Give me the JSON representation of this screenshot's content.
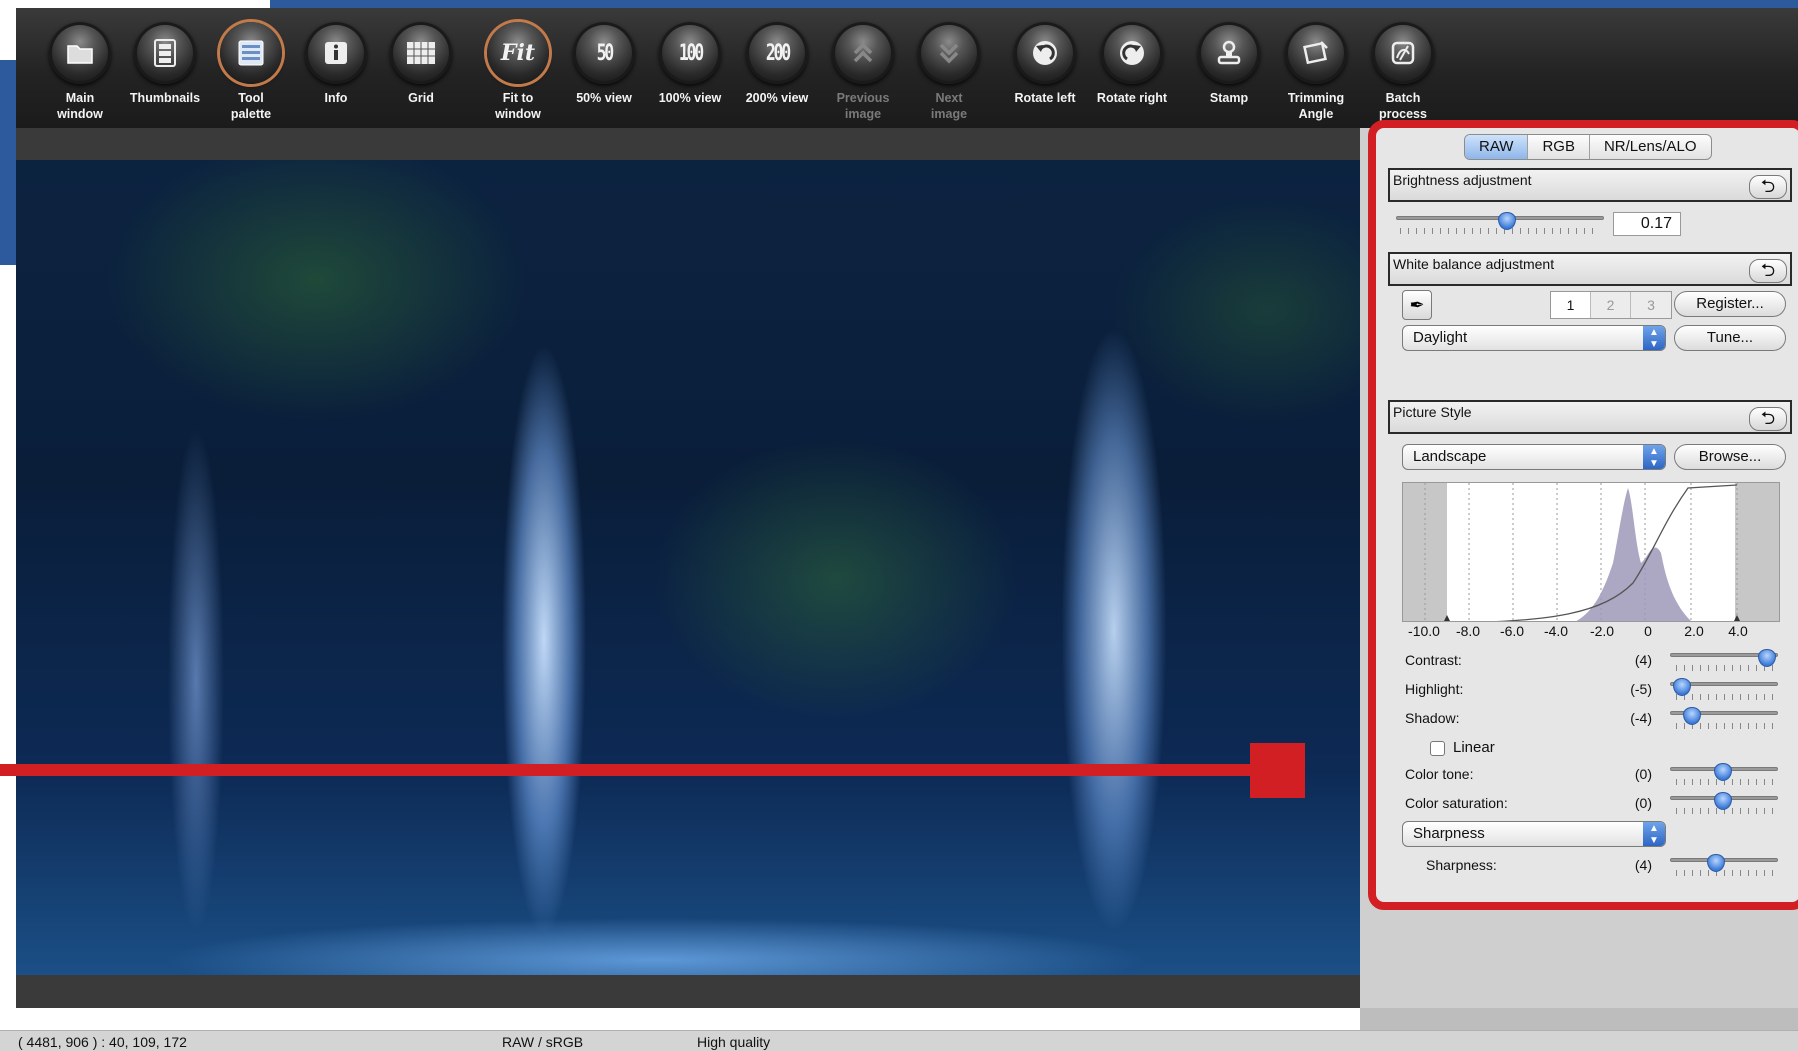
{
  "colors": {
    "toolbar_bg": "#232323",
    "callout_red": "#d21f24",
    "accent_blue": "#2c5a9c",
    "slider_thumb": "#3b7ad8"
  },
  "toolbar": {
    "buttons": [
      {
        "label": "Main\nwindow",
        "icon": "folder-icon"
      },
      {
        "label": "Thumbnails",
        "icon": "thumbnails-icon"
      },
      {
        "label": "Tool\npalette",
        "icon": "tool-palette-icon"
      },
      {
        "label": "Info",
        "icon": "info-icon"
      },
      {
        "label": "Grid",
        "icon": "grid-icon"
      },
      {
        "label": "Fit to\nwindow",
        "icon": "fit-icon",
        "glyph": "Fit"
      },
      {
        "label": "50% view",
        "icon": "zoom-50-icon",
        "glyph": "50"
      },
      {
        "label": "100% view",
        "icon": "zoom-100-icon",
        "glyph": "100"
      },
      {
        "label": "200% view",
        "icon": "zoom-200-icon",
        "glyph": "200"
      },
      {
        "label": "Previous\nimage",
        "icon": "previous-image-icon"
      },
      {
        "label": "Next\nimage",
        "icon": "next-image-icon"
      },
      {
        "label": "Rotate left",
        "icon": "rotate-left-icon"
      },
      {
        "label": "Rotate right",
        "icon": "rotate-right-icon"
      },
      {
        "label": "Stamp",
        "icon": "stamp-icon"
      },
      {
        "label": "Trimming\nAngle",
        "icon": "trimming-icon"
      },
      {
        "label": "Batch\nprocess",
        "icon": "batch-process-icon"
      }
    ]
  },
  "palette": {
    "tabs": [
      "RAW",
      "RGB",
      "NR/Lens/ALO"
    ],
    "selected_tab": "RAW",
    "brightness": {
      "title": "Brightness adjustment",
      "value": "0.17",
      "reset_icon": "reset-arrow-icon"
    },
    "white_balance": {
      "title": "White balance adjustment",
      "slots": [
        "1",
        "2",
        "3"
      ],
      "register_label": "Register...",
      "preset": "Daylight",
      "tune_label": "Tune...",
      "eyedropper_icon": "eyedropper-icon"
    },
    "picture_style": {
      "title": "Picture Style",
      "style": "Landscape",
      "browse_label": "Browse...",
      "curve_axis": [
        "-10.0",
        "-8.0",
        "-6.0",
        "-4.0",
        "-2.0",
        "0",
        "2.0",
        "4.0"
      ],
      "params": [
        {
          "label": "Contrast:",
          "value": "(4)",
          "level": 0.98
        },
        {
          "label": "Highlight:",
          "value": "(-5)",
          "level": 0.05
        },
        {
          "label": "Shadow:",
          "value": "(-4)",
          "level": 0.16
        },
        {
          "label": "Color tone:",
          "value": "(0)",
          "level": 0.5
        },
        {
          "label": "Color saturation:",
          "value": "(0)",
          "level": 0.5
        }
      ],
      "linear_label": "Linear",
      "linear_checked": false,
      "sharpness_select": "Sharpness",
      "sharpness_label": "Sharpness:",
      "sharpness_value": "(4)",
      "sharpness_level": 0.42
    }
  },
  "status": {
    "pixel_info": "( 4481,  906 ) :  40, 109, 172",
    "mode": "RAW / sRGB",
    "quality": "High quality"
  }
}
